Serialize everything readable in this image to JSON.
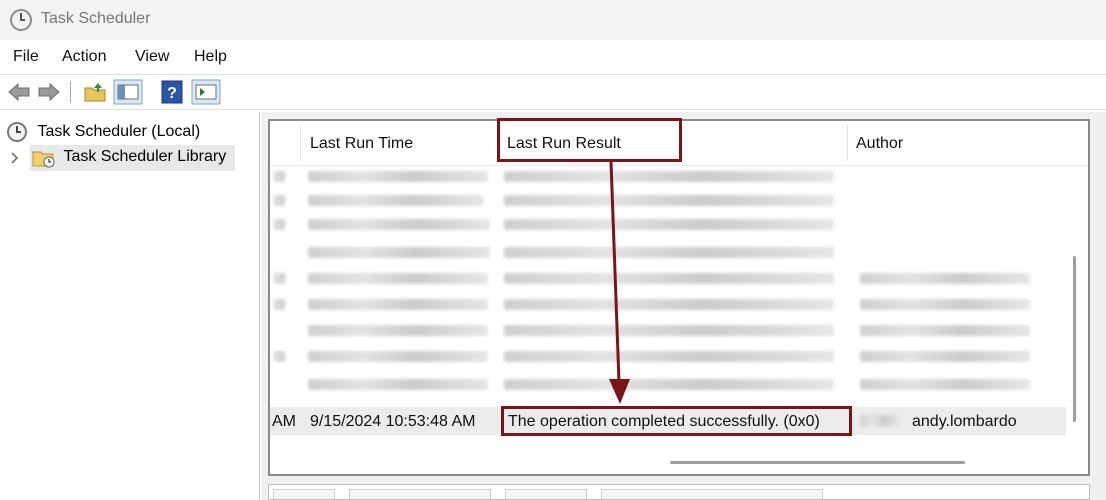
{
  "window": {
    "title": "Task Scheduler"
  },
  "menu": [
    "File",
    "Action",
    "View",
    "Help"
  ],
  "tree": {
    "root": "Task Scheduler (Local)",
    "library": "Task Scheduler Library"
  },
  "columns": {
    "last_run_time": "Last Run Time",
    "last_run_result": "Last Run Result",
    "author": "Author"
  },
  "selected_task": {
    "name_fragment": "AM",
    "last_run_time": "9/15/2024 10:53:48 AM",
    "last_run_result": "The operation completed successfully. (0x0)",
    "author": "andy.lombardo"
  },
  "colors": {
    "annotation": "#7b1419",
    "selection": "#ececec"
  }
}
